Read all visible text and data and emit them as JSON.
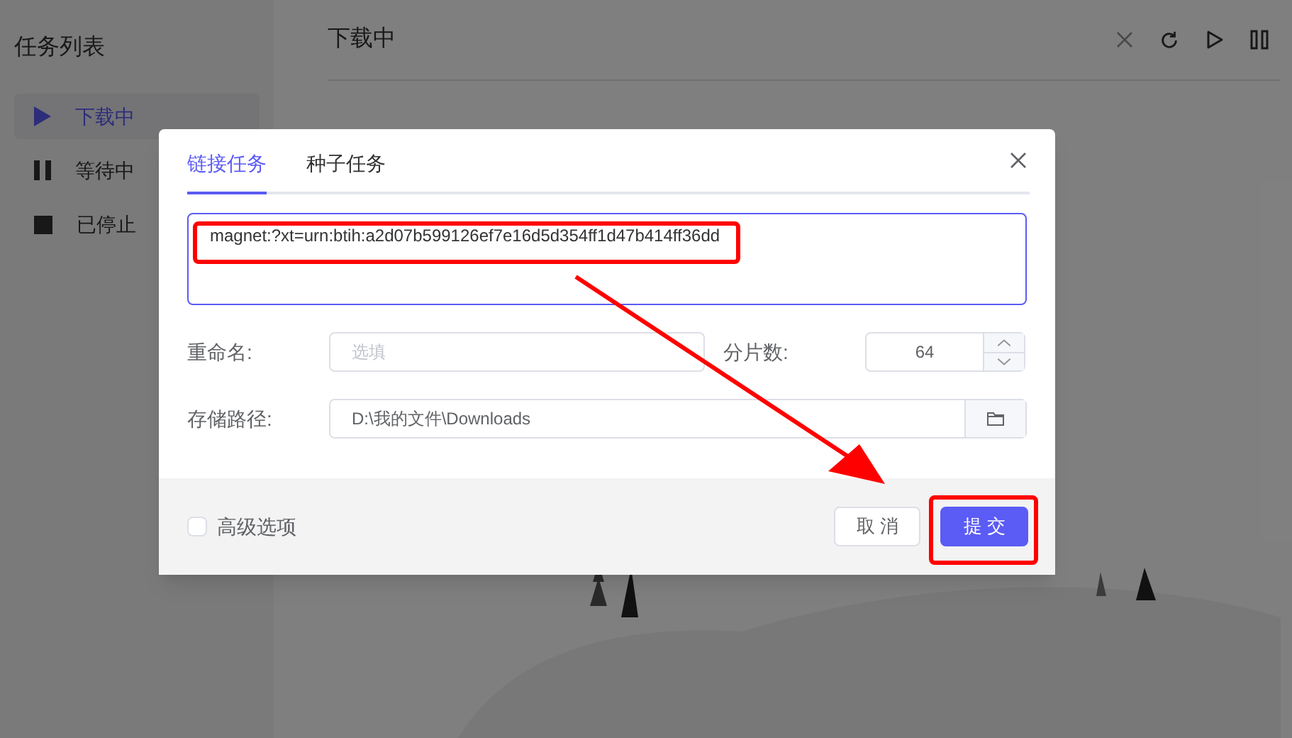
{
  "sidebar": {
    "title": "任务列表",
    "items": [
      {
        "label": "下载中",
        "kind": "play",
        "selected": true
      },
      {
        "label": "等待中",
        "kind": "pause",
        "selected": false
      },
      {
        "label": "已停止",
        "kind": "stop",
        "selected": false
      }
    ]
  },
  "main": {
    "title": "下载中"
  },
  "dialog": {
    "tabs": [
      {
        "label": "链接任务",
        "selected": true
      },
      {
        "label": "种子任务",
        "selected": false
      }
    ],
    "link": {
      "value": "magnet:?xt=urn:btih:a2d07b599126ef7e16d5d354ff1d47b414ff36dd"
    },
    "rename": {
      "label": "重命名:",
      "placeholder": "选填"
    },
    "splits": {
      "label": "分片数:",
      "value": "64"
    },
    "path": {
      "label": "存储路径:",
      "value": "D:\\我的文件\\Downloads"
    },
    "advanced": {
      "label": "高级选项",
      "checked": false
    },
    "buttons": [
      {
        "label": "取 消",
        "kind": "secondary"
      },
      {
        "label": "提 交",
        "kind": "primary"
      }
    ]
  }
}
